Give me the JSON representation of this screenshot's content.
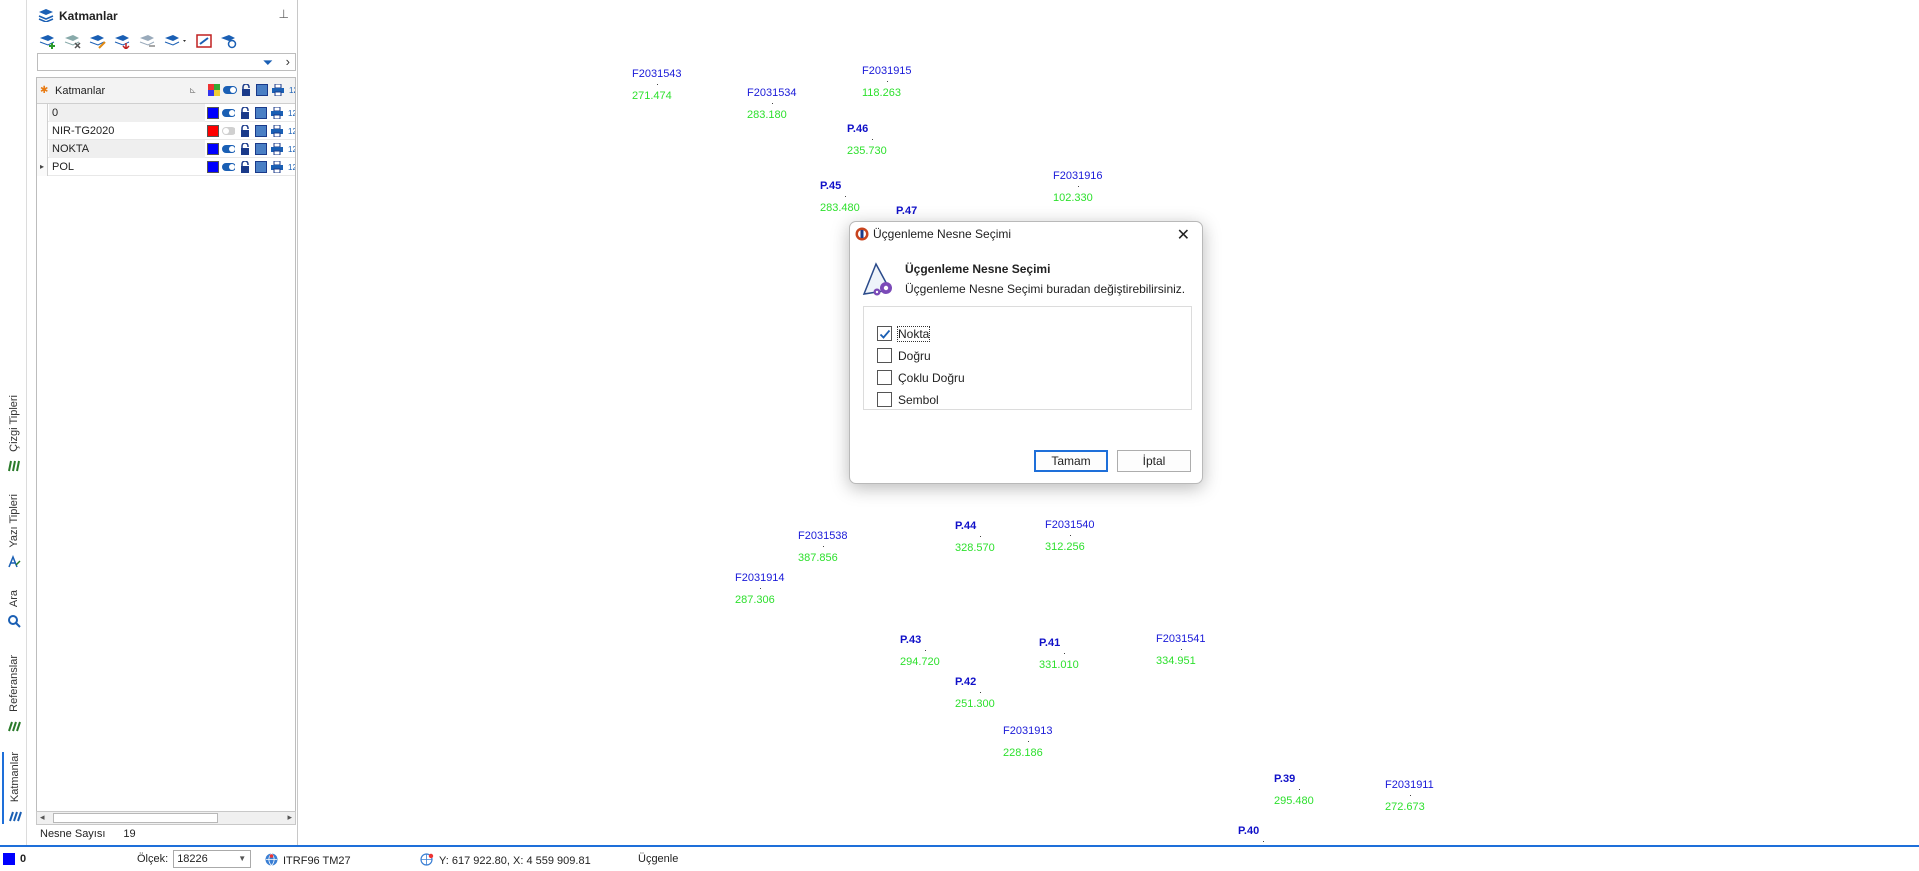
{
  "panel": {
    "title": "Katmanlar",
    "grid_header": "Katmanlar",
    "layers": [
      {
        "name": "0",
        "color": "#0000ff",
        "visible": true
      },
      {
        "name": "NIR-TG2020",
        "color": "#ff0000",
        "visible": false
      },
      {
        "name": "NOKTA",
        "color": "#0000ff",
        "visible": true
      },
      {
        "name": "POL",
        "color": "#0000ff",
        "visible": true,
        "expandable": true
      }
    ],
    "count_label": "Nesne Sayısı",
    "count_value": "19"
  },
  "vtabs": [
    "Katmanlar",
    "Referanslar",
    "Ara",
    "Yazı Tipleri",
    "Çizgi Tipleri"
  ],
  "status": {
    "layer": "0",
    "scale_label": "Ölçek:",
    "scale_value": "18226",
    "crs": "ITRF96 TM27",
    "coords": "Y: 617 922.80, X: 4 559 909.81",
    "mode": "Üçgenle"
  },
  "map_points": [
    {
      "name": "F2031543",
      "value": "271.474",
      "bold": false
    },
    {
      "name": "F2031534",
      "value": "283.180",
      "bold": false
    },
    {
      "name": "F2031915",
      "value": "118.263",
      "bold": false
    },
    {
      "name": "P.46",
      "value": "235.730",
      "bold": true
    },
    {
      "name": "P.45",
      "value": "283.480",
      "bold": true
    },
    {
      "name": "P.47",
      "value": "",
      "bold": true
    },
    {
      "name": "F2031916",
      "value": "102.330",
      "bold": false
    },
    {
      "name": "F2031538",
      "value": "387.856",
      "bold": false
    },
    {
      "name": "P.44",
      "value": "328.570",
      "bold": true
    },
    {
      "name": "F2031540",
      "value": "312.256",
      "bold": false
    },
    {
      "name": "F2031914",
      "value": "287.306",
      "bold": false
    },
    {
      "name": "P.43",
      "value": "294.720",
      "bold": true
    },
    {
      "name": "P.41",
      "value": "331.010",
      "bold": true
    },
    {
      "name": "F2031541",
      "value": "334.951",
      "bold": false
    },
    {
      "name": "P.42",
      "value": "251.300",
      "bold": true
    },
    {
      "name": "F2031913",
      "value": "228.186",
      "bold": false
    },
    {
      "name": "P.39",
      "value": "295.480",
      "bold": true
    },
    {
      "name": "F2031911",
      "value": "272.673",
      "bold": false
    },
    {
      "name": "P.40",
      "value": "",
      "bold": true
    }
  ],
  "dialog": {
    "title": "Üçgenleme Nesne Seçimi",
    "heading": "Üçgenleme Nesne Seçimi",
    "subtitle": "Üçgenleme Nesne Seçimi buradan değiştirebilirsiniz.",
    "options": [
      {
        "label": "Nokta",
        "checked": true
      },
      {
        "label": "Doğru",
        "checked": false
      },
      {
        "label": "Çoklu Doğru",
        "checked": false
      },
      {
        "label": "Sembol",
        "checked": false
      }
    ],
    "ok": "Tamam",
    "cancel": "İptal"
  }
}
